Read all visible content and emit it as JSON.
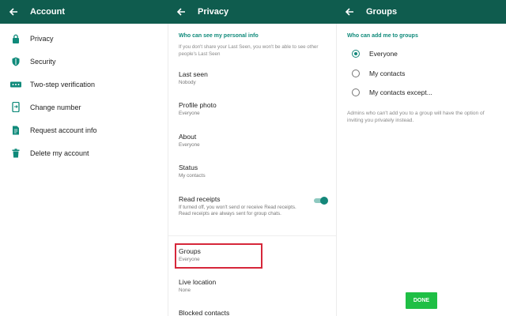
{
  "panels": {
    "account": {
      "title": "Account",
      "items": [
        {
          "label": "Privacy",
          "icon": "lock-icon"
        },
        {
          "label": "Security",
          "icon": "shield-icon"
        },
        {
          "label": "Two-step verification",
          "icon": "dots-icon"
        },
        {
          "label": "Change number",
          "icon": "phone-swap-icon"
        },
        {
          "label": "Request account info",
          "icon": "document-icon"
        },
        {
          "label": "Delete my account",
          "icon": "trash-icon"
        }
      ]
    },
    "privacy": {
      "title": "Privacy",
      "section_header": "Who can see my personal info",
      "section_note": "If you don't share your Last Seen, you won't be able to see other people's Last Seen",
      "items": [
        {
          "title": "Last seen",
          "subtitle": "Nobody"
        },
        {
          "title": "Profile photo",
          "subtitle": "Everyone"
        },
        {
          "title": "About",
          "subtitle": "Everyone"
        },
        {
          "title": "Status",
          "subtitle": "My contacts"
        },
        {
          "title": "Read receipts",
          "subtitle": "If turned off, you won't send or receive Read receipts. Read receipts are always sent for group chats."
        },
        {
          "title": "Groups",
          "subtitle": "Everyone"
        },
        {
          "title": "Live location",
          "subtitle": "None"
        },
        {
          "title": "Blocked contacts",
          "subtitle": ""
        }
      ],
      "read_receipts_on": true
    },
    "groups": {
      "title": "Groups",
      "section_header": "Who can add me to groups",
      "options": [
        {
          "label": "Everyone",
          "selected": true
        },
        {
          "label": "My contacts",
          "selected": false
        },
        {
          "label": "My contacts except...",
          "selected": false
        }
      ],
      "note": "Admins who can't add you to a group will have the option of inviting you privately instead.",
      "done_label": "DONE"
    }
  },
  "colors": {
    "appbar": "#0f5c4e",
    "accent": "#14877a",
    "highlight": "#d6273a",
    "done_button": "#1fbf45"
  }
}
